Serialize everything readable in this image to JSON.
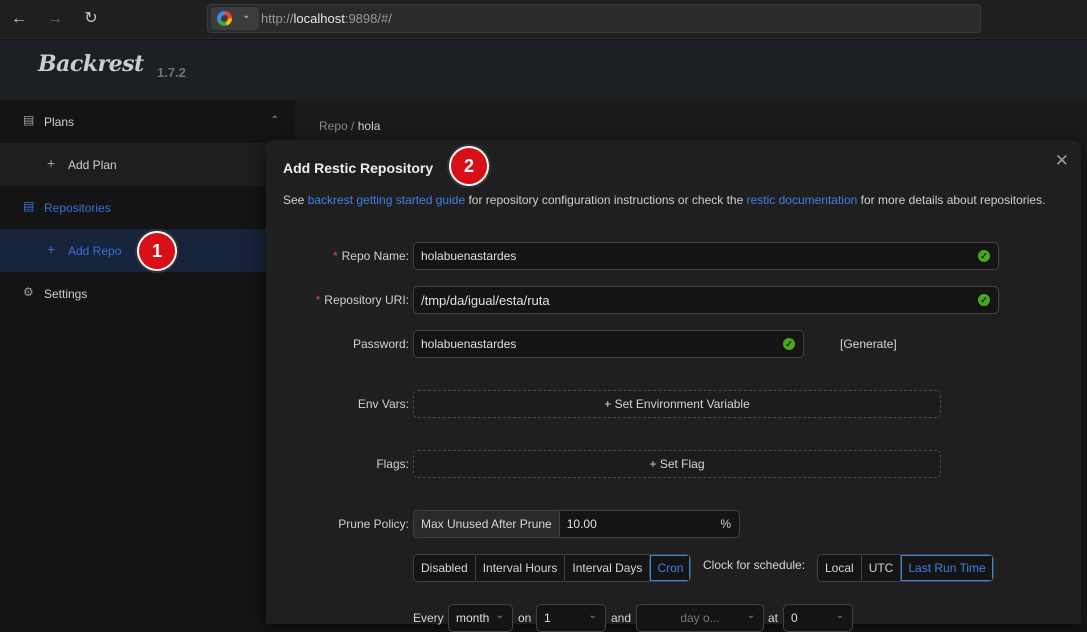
{
  "browser": {
    "url_prefix": "http://",
    "url_host": "localhost",
    "url_rest": ":9898/#/",
    "back_icon": "arrow-left-icon",
    "forward_icon": "arrow-right-icon",
    "reload_icon": "reload-icon"
  },
  "app": {
    "name": "Backrest",
    "version": "1.7.2"
  },
  "sidebar": {
    "plans": "Plans",
    "add_plan": "Add Plan",
    "repositories": "Repositories",
    "add_repo": "Add Repo",
    "settings": "Settings"
  },
  "breadcrumb": {
    "root": "Repo",
    "sep": "/",
    "current": "hola"
  },
  "modal": {
    "title": "Add Restic Repository",
    "desc_pre": "See ",
    "desc_link1": "backrest getting started guide",
    "desc_mid": " for repository configuration instructions or check the ",
    "desc_link2": "restic documentation",
    "desc_post": " for more details about repositories.",
    "repo_name_label": "Repo Name",
    "repo_name_value": "holabuenastardes",
    "repo_uri_label": "Repository URI",
    "repo_uri_value": "/tmp/da/igual/esta/ruta",
    "password_label": "Password",
    "password_value": "holabuenastardes",
    "generate": "[Generate]",
    "env_vars_label": "Env Vars",
    "env_vars_button": "Set Environment Variable",
    "flags_label": "Flags",
    "flags_button": "Set Flag",
    "prune_label": "Prune Policy",
    "prune_prefix": "Max Unused After Prune",
    "prune_value": "10.00",
    "prune_suffix": "%",
    "schedule_options": [
      "Disabled",
      "Interval Hours",
      "Interval Days",
      "Cron"
    ],
    "schedule_selected": "Cron",
    "clock_label": "Clock for schedule:",
    "clock_options": [
      "Local",
      "UTC",
      "Last Run Time"
    ],
    "clock_selected": "Last Run Time",
    "every_label": "Every",
    "every_value": "month",
    "on_label": "on",
    "on_value": "1",
    "and_label": "and",
    "day_placeholder": "day o...",
    "at_label": "at",
    "at_value": "0"
  },
  "annotations": {
    "badge1": "1",
    "badge2": "2"
  },
  "colors": {
    "accent": "#3f80e6",
    "required": "#e04848",
    "success": "#49aa19",
    "badge": "#d80f16"
  }
}
